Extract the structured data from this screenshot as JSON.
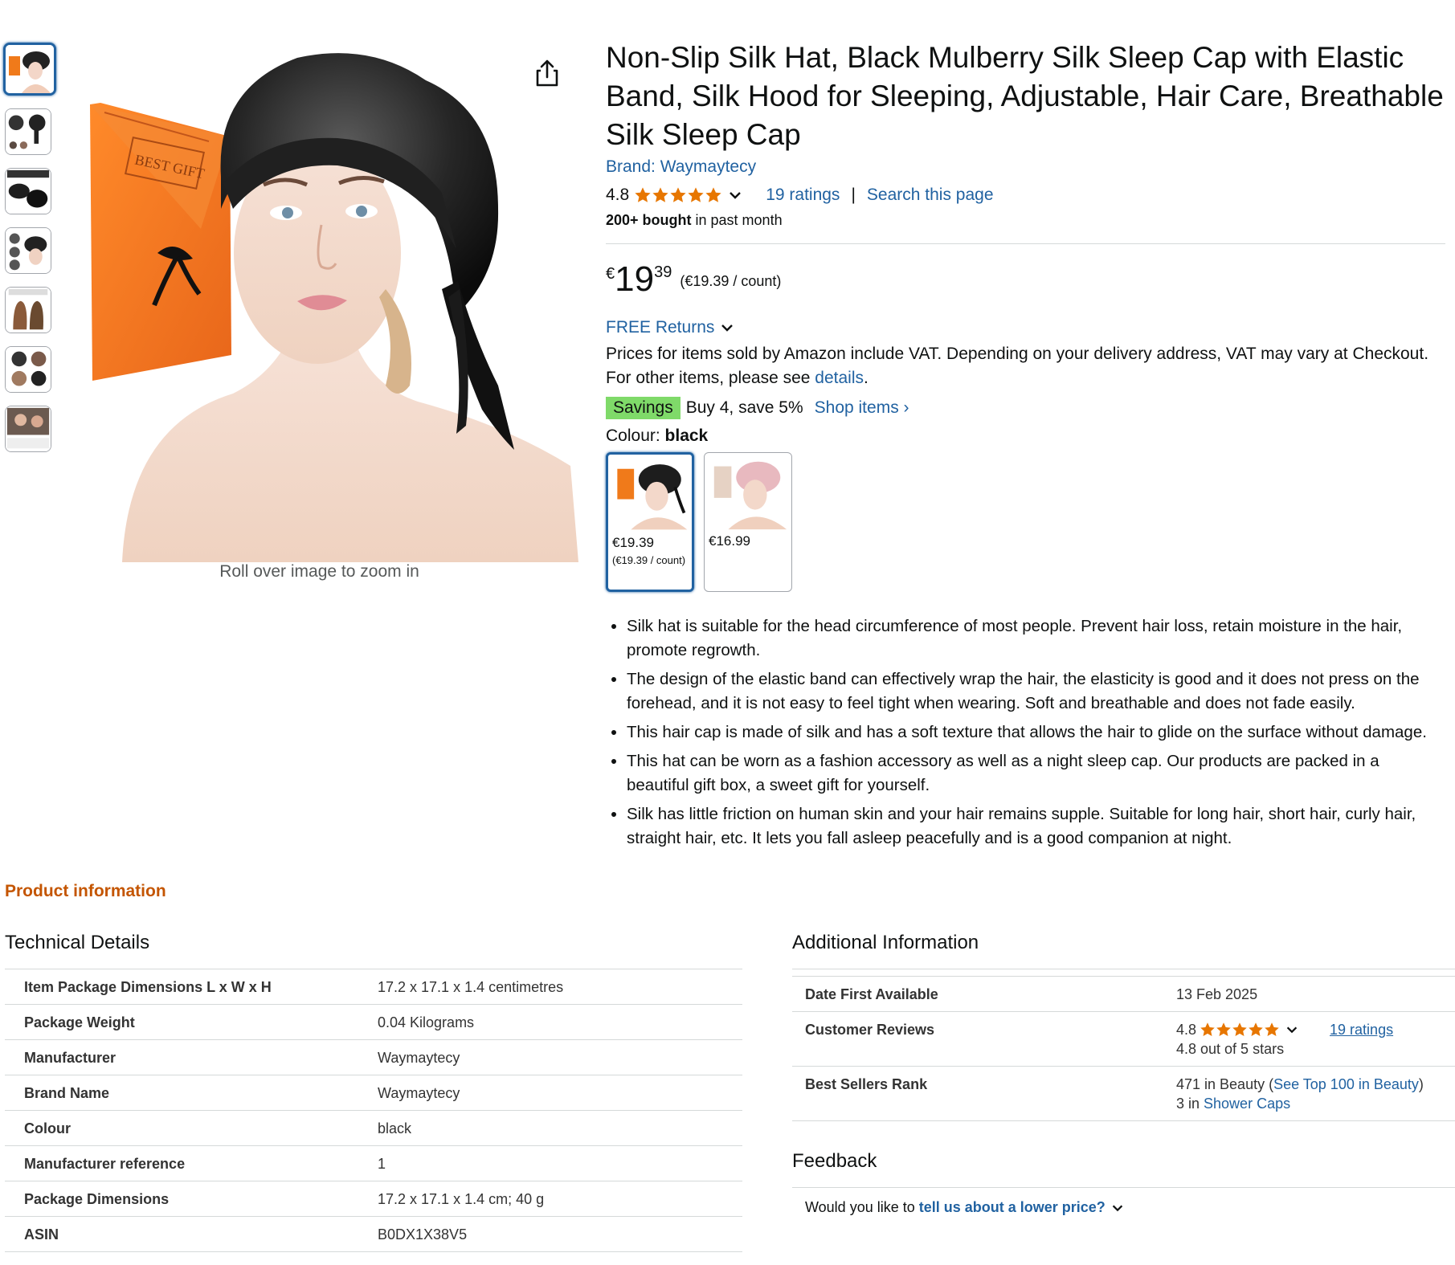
{
  "colors": {
    "link": "#2162a1",
    "star": "#e77600",
    "savings": "#7fda69",
    "section_heading": "#c45500",
    "selected_border": "#2162a1"
  },
  "gallery": {
    "thumbnails": [
      "thumb-1",
      "thumb-2",
      "thumb-3",
      "thumb-4",
      "thumb-5",
      "thumb-6",
      "thumb-7"
    ],
    "selected_index": 0,
    "zoom_hint": "Roll over image to zoom in",
    "gift_envelope_text": "BEST GIFT"
  },
  "product": {
    "title": "Non-Slip Silk Hat, Black Mulberry Silk Sleep Cap with Elastic Band, Silk Hood for Sleeping, Adjustable, Hair Care, Breathable Silk Sleep Cap",
    "brand": "Brand: Waymaytecy",
    "rating_value": "4.8",
    "rating_stars": 4.8,
    "ratings_count": "19 ratings",
    "rating_separator": "|",
    "search_page": "Search this page",
    "bought_bold": "200+ bought",
    "bought_rest": " in past month",
    "price": {
      "currency": "€",
      "whole": "19",
      "fraction": "39",
      "unit": "(€19.39 / count)"
    },
    "free_returns": "FREE Returns",
    "vat_text": "Prices for items sold by Amazon include VAT. Depending on your delivery address, VAT may vary at Checkout. For other items, please see ",
    "vat_link": "details",
    "vat_end": ".",
    "savings_badge": "Savings",
    "savings_text": "Buy 4, save 5%",
    "shop_items": "Shop items ›",
    "colour_label": "Colour: ",
    "colour_value": "black",
    "swatches": [
      {
        "price": "€19.39",
        "unit": "(€19.39 / count)",
        "selected": true
      },
      {
        "price": "€16.99",
        "unit": "",
        "selected": false
      }
    ],
    "bullets": [
      "Silk hat is suitable for the head circumference of most people. Prevent hair loss, retain moisture in the hair, promote regrowth.",
      "The design of the elastic band can effectively wrap the hair, the elasticity is good and it does not press on the forehead, and it is not easy to feel tight when wearing. Soft and breathable and does not fade easily.",
      "This hair cap is made of silk and has a soft texture that allows the hair to glide on the surface without damage.",
      "This hat can be worn as a fashion accessory as well as a night sleep cap. Our products are packed in a beautiful gift box, a sweet gift for yourself.",
      "Silk has little friction on human skin and your hair remains supple. Suitable for long hair, short hair, curly hair, straight hair, etc. It lets you fall asleep peacefully and is a good companion at night."
    ]
  },
  "product_information": {
    "heading": "Product information",
    "technical_details": {
      "heading": "Technical Details",
      "rows": [
        {
          "k": "Item Package Dimensions L x W x H",
          "v": "17.2 x 17.1 x 1.4 centimetres"
        },
        {
          "k": "Package Weight",
          "v": "0.04 Kilograms"
        },
        {
          "k": "Manufacturer",
          "v": "Waymaytecy"
        },
        {
          "k": "Brand Name",
          "v": "Waymaytecy"
        },
        {
          "k": "Colour",
          "v": "black"
        },
        {
          "k": "Manufacturer reference",
          "v": "1"
        },
        {
          "k": "Package Dimensions",
          "v": "17.2 x 17.1 x 1.4 cm; 40 g"
        },
        {
          "k": "ASIN",
          "v": "B0DX1X38V5"
        }
      ]
    },
    "additional_information": {
      "heading": "Additional Information",
      "date_first_available_label": "Date First Available",
      "date_first_available": "13 Feb 2025",
      "customer_reviews_label": "Customer Reviews",
      "reviews_value": "4.8",
      "reviews_link": "19 ratings",
      "reviews_out_of": "4.8 out of 5 stars",
      "best_sellers_label": "Best Sellers Rank",
      "rank1_text": "471 in Beauty (",
      "rank1_link": "See Top 100 in Beauty",
      "rank1_end": ")",
      "rank2_text": "3 in ",
      "rank2_link": "Shower Caps"
    },
    "feedback": {
      "heading": "Feedback",
      "prompt": "Would you like to",
      "link": "tell us about a lower price?"
    }
  }
}
